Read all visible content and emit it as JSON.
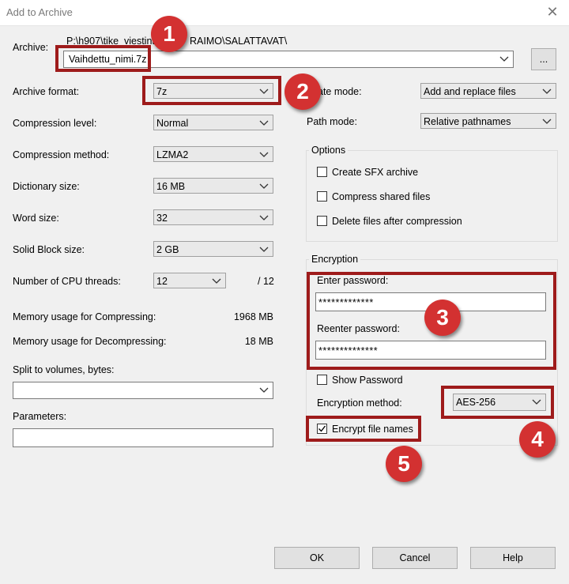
{
  "window": {
    "title": "Add to Archive",
    "close_glyph": "✕"
  },
  "archive": {
    "label": "Archive:",
    "path": "P:\\h907\\tike_viestint",
    "path_tail": "RAIMO\\SALATTAVAT\\",
    "value": "Vaihdettu_nimi.7z",
    "browse_label": "..."
  },
  "left": {
    "format": {
      "label": "Archive format:",
      "value": "7z"
    },
    "level": {
      "label": "Compression level:",
      "value": "Normal"
    },
    "method": {
      "label": "Compression method:",
      "value": "LZMA2"
    },
    "dict": {
      "label": "Dictionary size:",
      "value": "16 MB"
    },
    "word": {
      "label": "Word size:",
      "value": "32"
    },
    "solid": {
      "label": "Solid Block size:",
      "value": "2 GB"
    },
    "threads": {
      "label": "Number of CPU threads:",
      "value": "12",
      "max": "/ 12"
    },
    "mem_comp": {
      "label": "Memory usage for Compressing:",
      "value": "1968 MB"
    },
    "mem_decomp": {
      "label": "Memory usage for Decompressing:",
      "value": "18 MB"
    },
    "split": {
      "label": "Split to volumes, bytes:",
      "value": ""
    },
    "params": {
      "label": "Parameters:",
      "value": ""
    }
  },
  "right": {
    "update": {
      "label": "ate mode:",
      "value": "Add and replace files"
    },
    "pathmode": {
      "label": "Path mode:",
      "value": "Relative pathnames"
    },
    "options": {
      "title": "Options",
      "sfx": "Create SFX archive",
      "shared": "Compress shared files",
      "delete": "Delete files after compression"
    },
    "encryption": {
      "title": "Encryption",
      "enter_label": "Enter password:",
      "enter_value": "*************",
      "reenter_label": "Reenter password:",
      "reenter_value": "**************",
      "show_password": "Show Password",
      "method_label": "Encryption method:",
      "method_value": "AES-256",
      "encrypt_names": "Encrypt file names"
    }
  },
  "buttons": {
    "ok": "OK",
    "cancel": "Cancel",
    "help": "Help"
  },
  "badges": [
    "1",
    "2",
    "3",
    "4",
    "5"
  ],
  "colors": {
    "annotation_box": "#9e1b1b",
    "badge": "#d33131"
  }
}
